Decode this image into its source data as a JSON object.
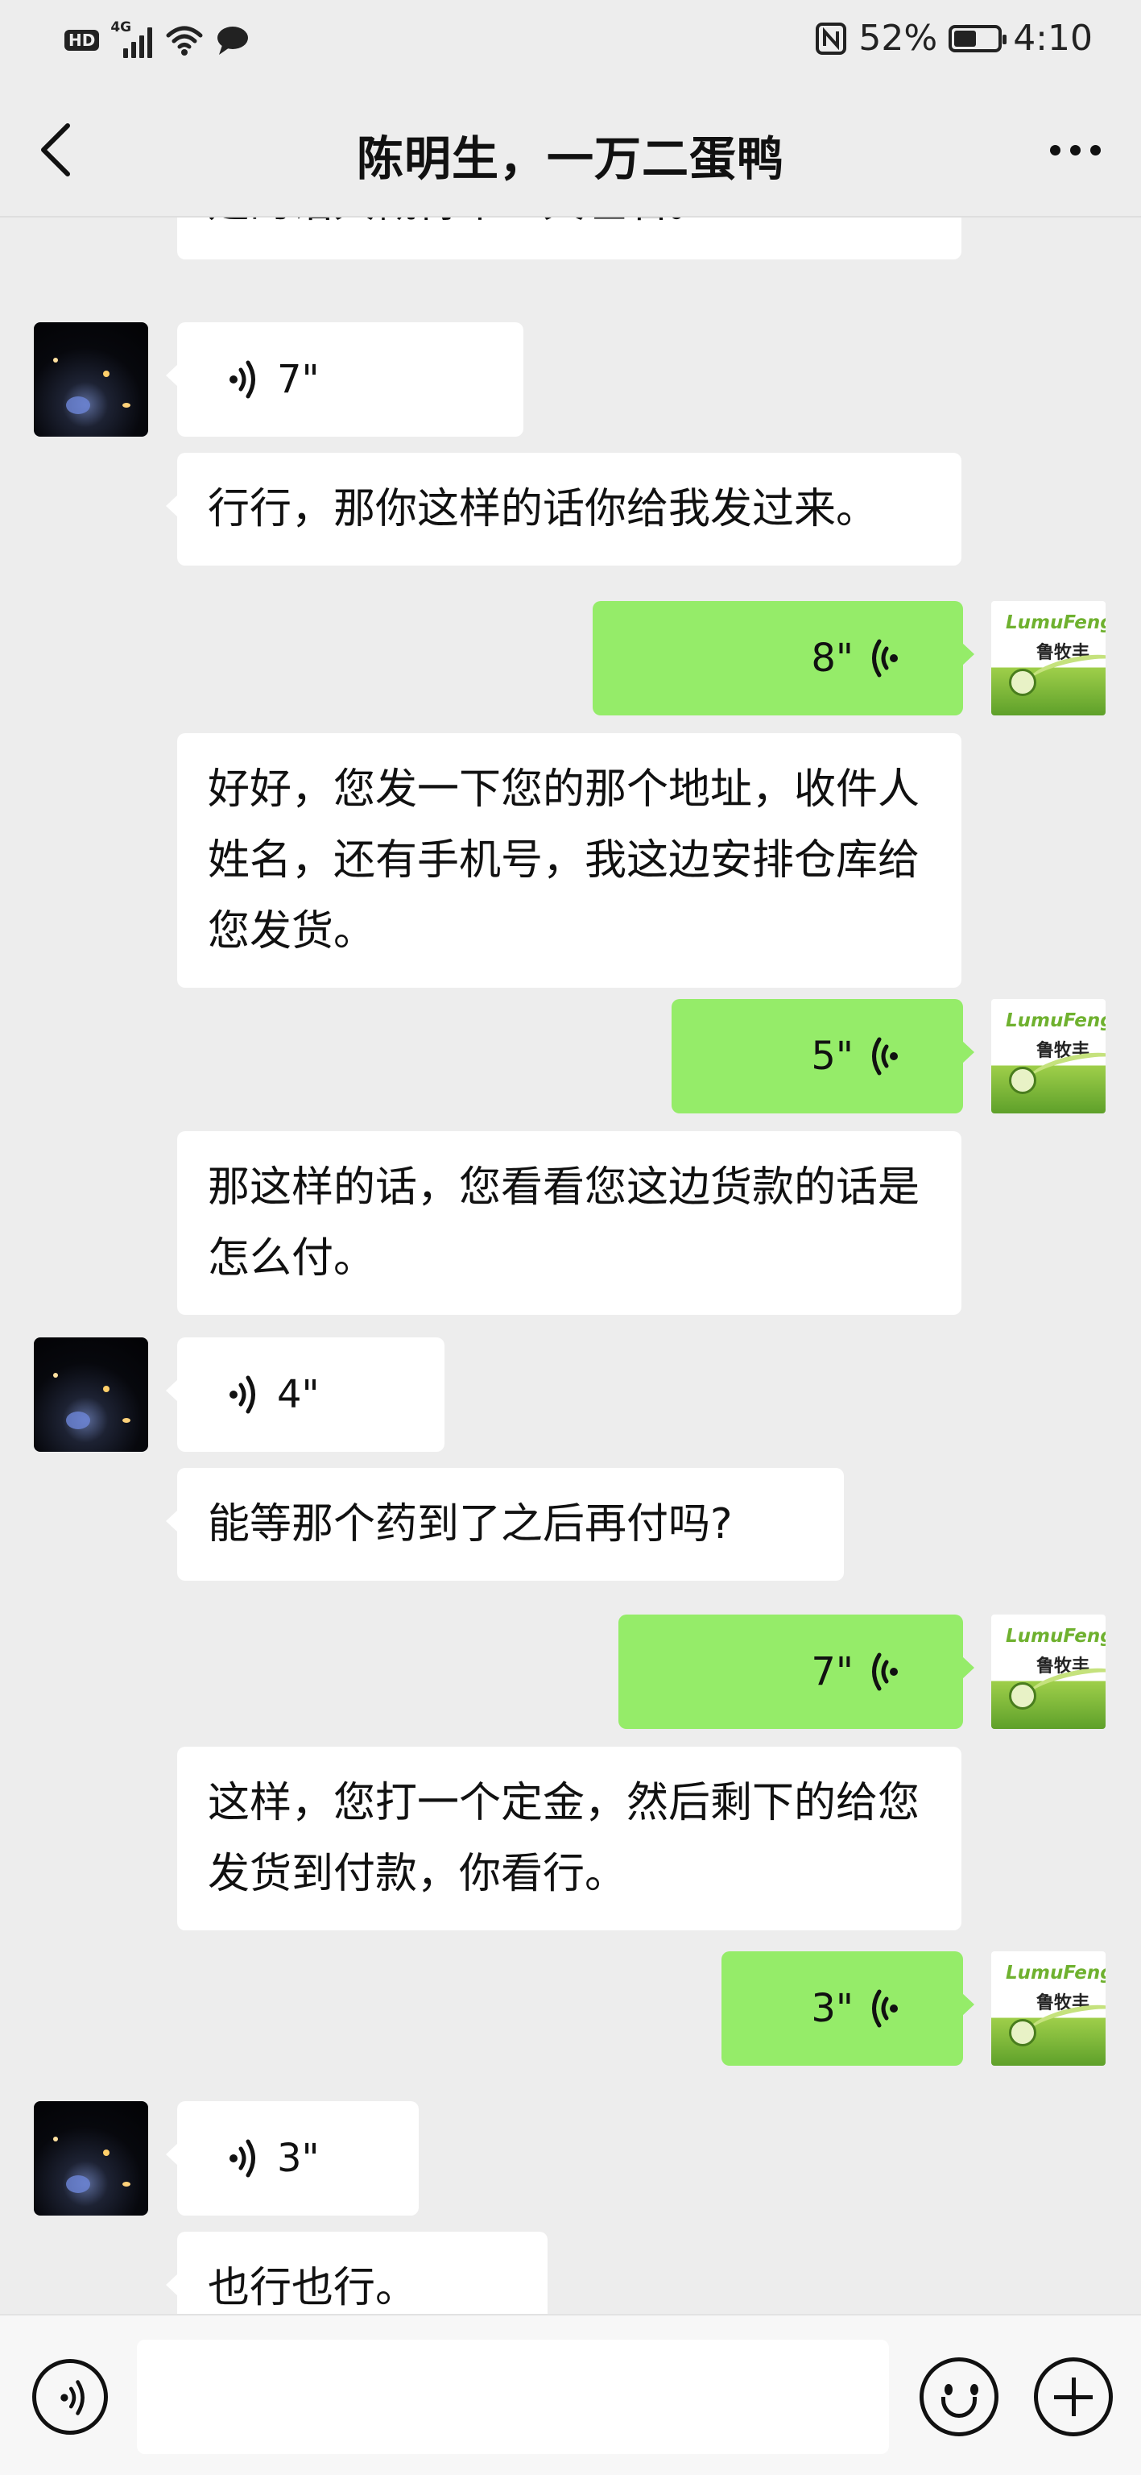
{
  "status_bar": {
    "hd_badge": "HD",
    "network": "4G",
    "battery_text": "52%",
    "battery_level": 0.52,
    "time": "4:10",
    "icons": [
      "signal-icon",
      "wifi-icon",
      "message-icon",
      "nfc-icon",
      "battery-icon"
    ]
  },
  "header": {
    "title": "陈明生，一万二蛋鸭",
    "back_icon": "back-arrow-icon",
    "more_icon": "more-options-icon"
  },
  "messages": [
    {
      "side": "left",
      "type": "text",
      "text": "建的话大概得个三天左右。"
    },
    {
      "side": "left",
      "type": "voice",
      "duration": "7\""
    },
    {
      "side": "left",
      "type": "text",
      "text": "行行，那你这样的话你给我发过来。"
    },
    {
      "side": "right",
      "type": "voice",
      "duration": "8\""
    },
    {
      "side": "left",
      "type": "text",
      "text": "好好，您发一下您的那个地址，收件人姓名，还有手机号，我这边安排仓库给您发货。"
    },
    {
      "side": "right",
      "type": "voice",
      "duration": "5\""
    },
    {
      "side": "left",
      "type": "text",
      "text": "那这样的话，您看看您这边货款的话是怎么付。"
    },
    {
      "side": "left",
      "type": "voice",
      "duration": "4\""
    },
    {
      "side": "left",
      "type": "text",
      "text": "能等那个药到了之后再付吗?"
    },
    {
      "side": "right",
      "type": "voice",
      "duration": "7\""
    },
    {
      "side": "left",
      "type": "text",
      "text": "这样，您打一个定金，然后剩下的给您发货到付款，你看行。"
    },
    {
      "side": "right",
      "type": "voice",
      "duration": "3\""
    },
    {
      "side": "left",
      "type": "voice",
      "duration": "3\""
    },
    {
      "side": "left",
      "type": "text",
      "text": "也行也行。"
    }
  ],
  "avatars": {
    "contact": "night-city-photo",
    "me": {
      "logo_text": "LumuFeng",
      "logo_cn": "鲁牧丰"
    }
  },
  "input_bar": {
    "voice_icon": "voice-mode-icon",
    "input_value": "",
    "emoji_icon": "emoji-icon",
    "plus_icon": "plus-icon"
  },
  "colors": {
    "background": "#ededed",
    "bubble_self": "#95ec69",
    "bubble_other": "#ffffff",
    "input_bar": "#f7f7f7"
  }
}
